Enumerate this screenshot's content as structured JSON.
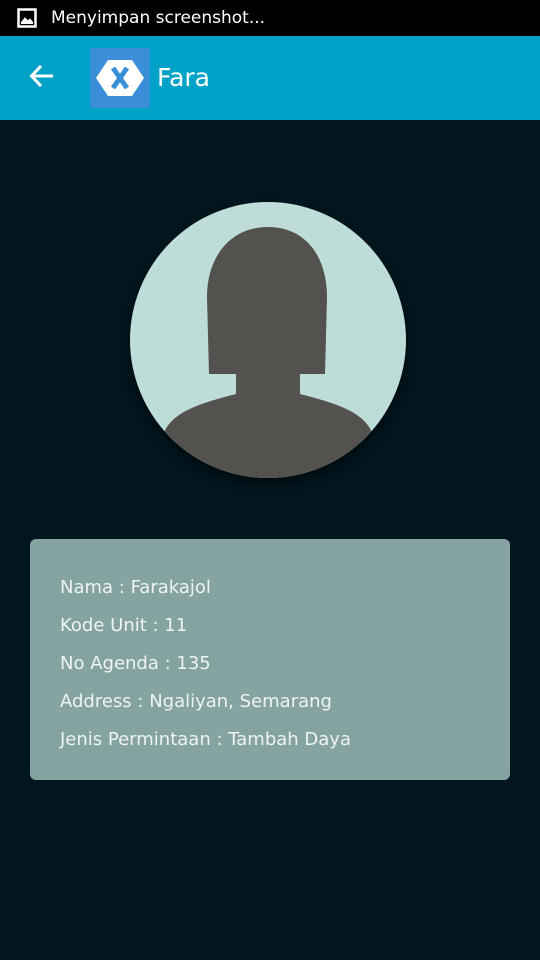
{
  "status_bar": {
    "notification_icon": "screenshot-image-icon",
    "text": "Menyimpan screenshot..."
  },
  "app_bar": {
    "back_icon": "arrow-left-icon",
    "logo_icon": "xamarin-x-logo",
    "title": "Fara",
    "background_color": "#00a2c8"
  },
  "profile": {
    "avatar_icon": "female-silhouette-avatar"
  },
  "info": {
    "nama": "Nama : Farakajol",
    "kode_unit": "Kode Unit : 11",
    "no_agenda": "No Agenda : 135",
    "address": "Address : Ngaliyan, Semarang",
    "jenis_permintaan": "Jenis Permintaan : Tambah Daya"
  },
  "colors": {
    "page_background": "#01161e",
    "card_background": "#85a3a1",
    "avatar_background": "#bedcd8",
    "silhouette": "#53524e"
  }
}
